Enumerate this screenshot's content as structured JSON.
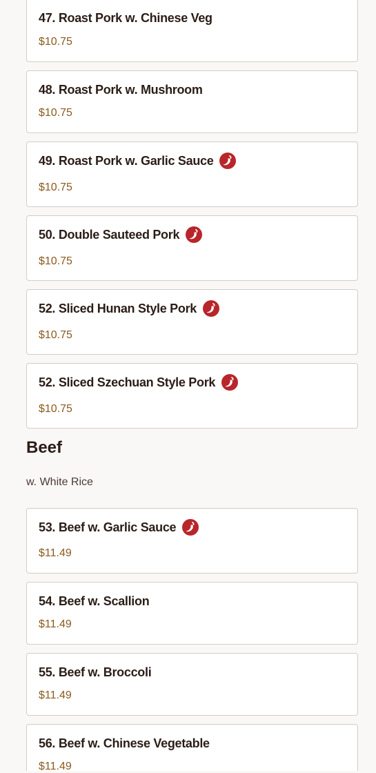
{
  "pork_items": [
    {
      "name": "47. Roast Pork w. Chinese Veg",
      "price": "$10.75",
      "spicy": false
    },
    {
      "name": "48. Roast Pork w. Mushroom",
      "price": "$10.75",
      "spicy": false
    },
    {
      "name": "49. Roast Pork w. Garlic Sauce",
      "price": "$10.75",
      "spicy": true
    },
    {
      "name": "50. Double Sauteed Pork",
      "price": "$10.75",
      "spicy": true
    },
    {
      "name": "52. Sliced Hunan Style Pork",
      "price": "$10.75",
      "spicy": true
    },
    {
      "name": "52. Sliced Szechuan Style Pork",
      "price": "$10.75",
      "spicy": true
    }
  ],
  "beef_section": {
    "title": "Beef",
    "subtitle": "w. White Rice"
  },
  "beef_items": [
    {
      "name": "53. Beef w. Garlic Sauce",
      "price": "$11.49",
      "spicy": true
    },
    {
      "name": "54. Beef w. Scallion",
      "price": "$11.49",
      "spicy": false
    },
    {
      "name": "55. Beef w. Broccoli",
      "price": "$11.49",
      "spicy": false
    },
    {
      "name": "56. Beef w. Chinese Vegetable",
      "price": "$11.49",
      "spicy": false
    }
  ],
  "colors": {
    "spicy_icon": "#b8262b",
    "price": "#8a5a1e",
    "card_border": "#d2ccc7"
  }
}
